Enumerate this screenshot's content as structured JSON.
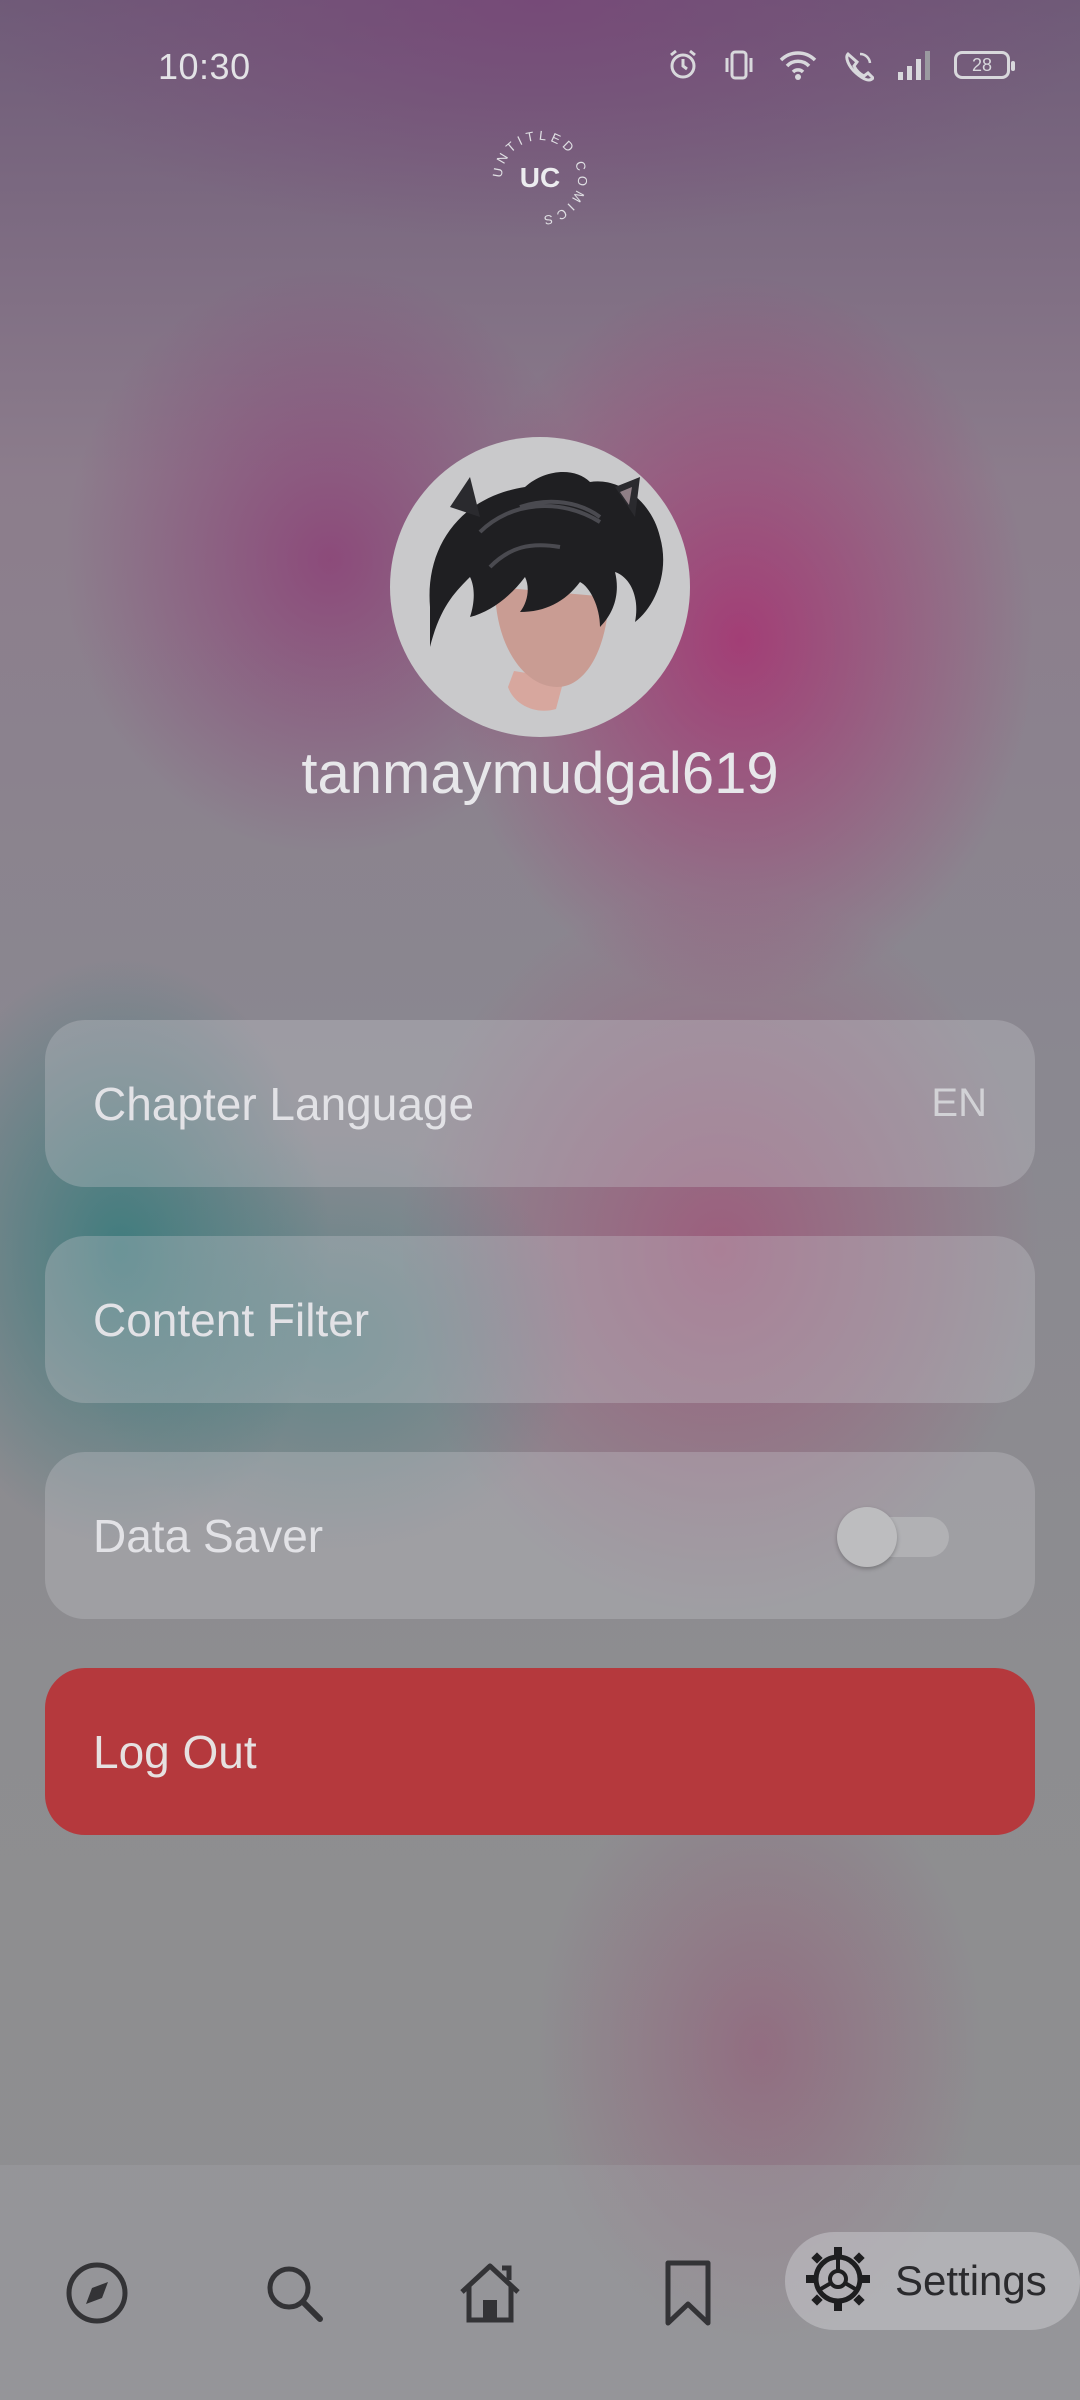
{
  "status_bar": {
    "time": "10:30",
    "battery_level": "28",
    "icons": [
      "alarm-icon",
      "vibrate-icon",
      "wifi-icon",
      "wifi-calling-icon",
      "signal-icon",
      "battery-icon"
    ]
  },
  "app": {
    "logo_letters": "UC",
    "logo_ring_text": "UNTITLED COMICS"
  },
  "profile": {
    "username": "tanmaymudgal619"
  },
  "settings": {
    "chapter_language": {
      "label": "Chapter Language",
      "value": "EN"
    },
    "content_filter": {
      "label": "Content Filter"
    },
    "data_saver": {
      "label": "Data Saver",
      "enabled": false
    },
    "logout": {
      "label": "Log Out"
    }
  },
  "bottom_nav": {
    "items": [
      {
        "icon": "compass-icon",
        "name": "Explore"
      },
      {
        "icon": "search-icon",
        "name": "Search"
      },
      {
        "icon": "home-icon",
        "name": "Home"
      },
      {
        "icon": "bookmark-icon",
        "name": "Bookmarks"
      },
      {
        "icon": "gear-icon",
        "label": "Settings",
        "active": true
      }
    ]
  },
  "colors": {
    "logout_button": "#b5393d",
    "text_light": "#e2e2e6"
  }
}
